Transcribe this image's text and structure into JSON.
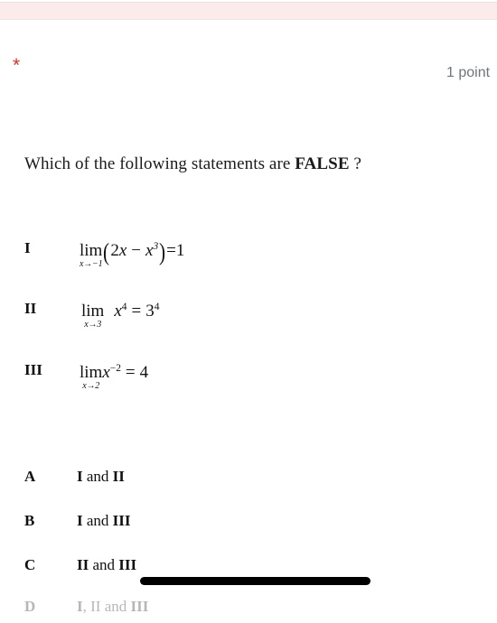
{
  "banner": {
    "color": "#fbeceb",
    "name": "required-error-banner"
  },
  "header": {
    "required_marker": "*",
    "required_marker_color": "#d93025",
    "points_label": "1 point"
  },
  "question": {
    "prefix": "Which of the following statements are ",
    "emphasis": "FALSE",
    "suffix": " ?"
  },
  "statements": [
    {
      "label": "I",
      "lim_word": "lim",
      "lim_sub": "x→−1",
      "open_paren": "(",
      "coefficient": "2",
      "var1": "x",
      "minus": "−",
      "var2": "x",
      "exponent": "3",
      "close_paren": ")",
      "equals": "=",
      "result": "1",
      "plain": "lim (x→−1) (2x − x³) = 1"
    },
    {
      "label": "II",
      "lim_word": "lim",
      "lim_sub": "x→3",
      "var1": "x",
      "exponent": "4",
      "equals": "=",
      "result_base": "3",
      "result_exponent": "4",
      "plain": "lim (x→3) x⁴ = 3⁴"
    },
    {
      "label": "III",
      "lim_word": "lim",
      "lim_sub": "x→2",
      "var1": "x",
      "exponent": "−2",
      "equals": "=",
      "result": "4",
      "plain": "lim (x→2) x⁻² = 4"
    }
  ],
  "options": [
    {
      "letter": "A",
      "first": "I",
      "conj": " and ",
      "second": "II",
      "full": "I and II"
    },
    {
      "letter": "B",
      "first": "I",
      "conj": " and ",
      "second": "III",
      "full": "I and III"
    },
    {
      "letter": "C",
      "first": "II",
      "conj": " and ",
      "second": "III",
      "full": "II and III"
    },
    {
      "letter": "D",
      "first": "I",
      "conj": ", II and ",
      "second": "III",
      "full": "I, II and III"
    }
  ],
  "bottom_bar": {
    "color": "#000000",
    "name": "scroll-indicator"
  }
}
